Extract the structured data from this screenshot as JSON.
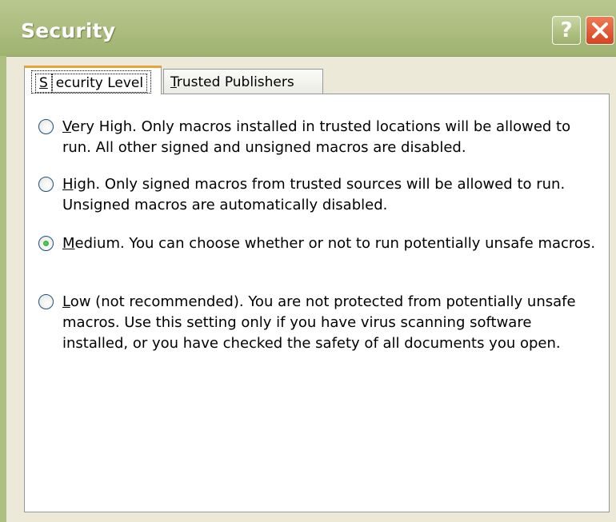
{
  "window": {
    "title": "Security",
    "help_label": "?",
    "close_label": "✕"
  },
  "tabs": [
    {
      "label_u": "S",
      "label_rest": "ecurity Level"
    },
    {
      "label_u": "T",
      "label_rest": "rusted Publishers"
    }
  ],
  "options": [
    {
      "label_u": "V",
      "label_rest": "ery High. Only macros installed in trusted locations will be allowed to run. All other signed and unsigned macros are disabled.",
      "checked": false
    },
    {
      "label_u": "H",
      "label_rest": "igh. Only signed macros from trusted sources will be allowed to run. Unsigned macros are automatically disabled.",
      "checked": false
    },
    {
      "label_u": "M",
      "label_rest": "edium. You can choose whether or not to run potentially unsafe macros.",
      "checked": true
    },
    {
      "label_u": "L",
      "label_rest": "ow (not recommended). You are not protected from potentially unsafe macros. Use this setting only if you have virus scanning software installed, or you have checked the safety of all documents you open.",
      "checked": false
    }
  ]
}
